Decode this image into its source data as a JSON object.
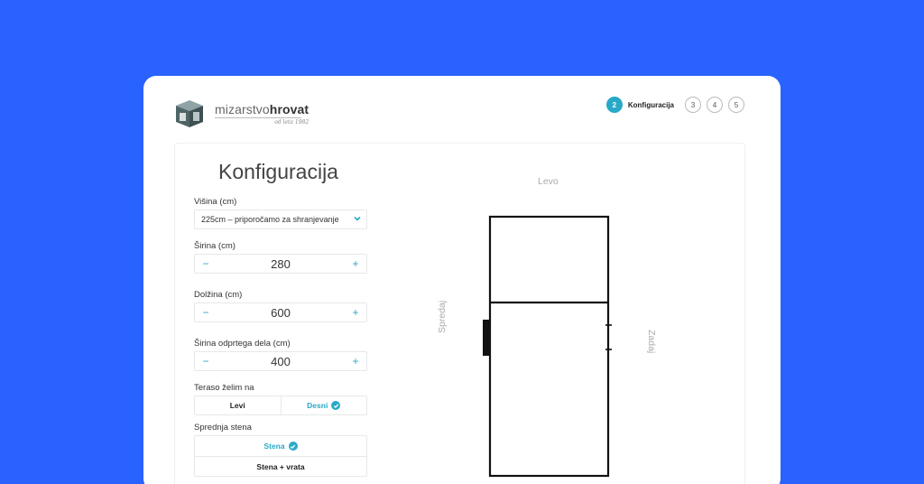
{
  "brand": {
    "name_light": "mizarstvo",
    "name_bold": "hrovat",
    "tagline": "od leta 1982"
  },
  "steps": {
    "active_number": "2",
    "active_label": "Konfiguracija",
    "next": [
      "3",
      "4",
      "5"
    ]
  },
  "page": {
    "title": "Konfiguracija"
  },
  "form": {
    "height_label": "Višina (cm)",
    "height_value": "225cm – priporočamo za shranjevanje",
    "width_label": "Širina (cm)",
    "width_value": "280",
    "length_label": "Dolžina (cm)",
    "length_value": "600",
    "open_width_label": "Širina odprtega dela (cm)",
    "open_width_value": "400",
    "terrace_label": "Teraso želim na",
    "terrace_options": [
      "Levi",
      "Desni"
    ],
    "terrace_selected": "Desni",
    "front_wall_label": "Sprednja stena",
    "front_wall_options": [
      "Stena",
      "Stena + vrata"
    ],
    "front_wall_selected": "Stena",
    "minus": "−",
    "plus": "+"
  },
  "drawing": {
    "top": "Levo",
    "left": "Spredaj",
    "right": "Zadaj"
  },
  "colors": {
    "background": "#2962ff",
    "accent": "#29a9c8"
  }
}
